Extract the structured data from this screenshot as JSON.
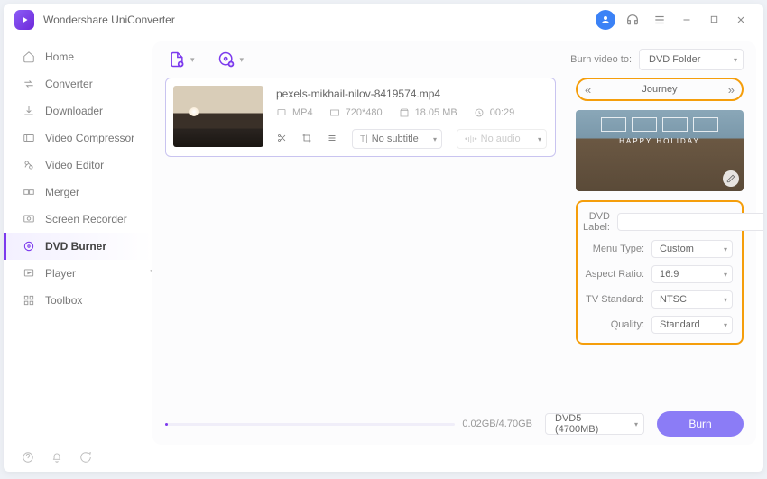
{
  "app_title": "Wondershare UniConverter",
  "sidebar": {
    "items": [
      {
        "label": "Home"
      },
      {
        "label": "Converter"
      },
      {
        "label": "Downloader"
      },
      {
        "label": "Video Compressor"
      },
      {
        "label": "Video Editor"
      },
      {
        "label": "Merger"
      },
      {
        "label": "Screen Recorder"
      },
      {
        "label": "DVD Burner"
      },
      {
        "label": "Player"
      },
      {
        "label": "Toolbox"
      }
    ]
  },
  "toolbar": {
    "burn_to_label": "Burn video to:",
    "burn_to_value": "DVD Folder"
  },
  "file": {
    "name": "pexels-mikhail-nilov-8419574.mp4",
    "format": "MP4",
    "resolution": "720*480",
    "size": "18.05 MB",
    "duration": "00:29",
    "subtitle": "No subtitle",
    "audio": "No audio"
  },
  "template": {
    "name": "Journey",
    "caption": "HAPPY HOLIDAY"
  },
  "settings": {
    "dvd_label_label": "DVD Label:",
    "dvd_label_value": "",
    "menu_type_label": "Menu Type:",
    "menu_type_value": "Custom",
    "aspect_ratio_label": "Aspect Ratio:",
    "aspect_ratio_value": "16:9",
    "tv_standard_label": "TV Standard:",
    "tv_standard_value": "NTSC",
    "quality_label": "Quality:",
    "quality_value": "Standard"
  },
  "footer": {
    "progress_text": "0.02GB/4.70GB",
    "disc_select": "DVD5 (4700MB)",
    "burn_label": "Burn"
  }
}
